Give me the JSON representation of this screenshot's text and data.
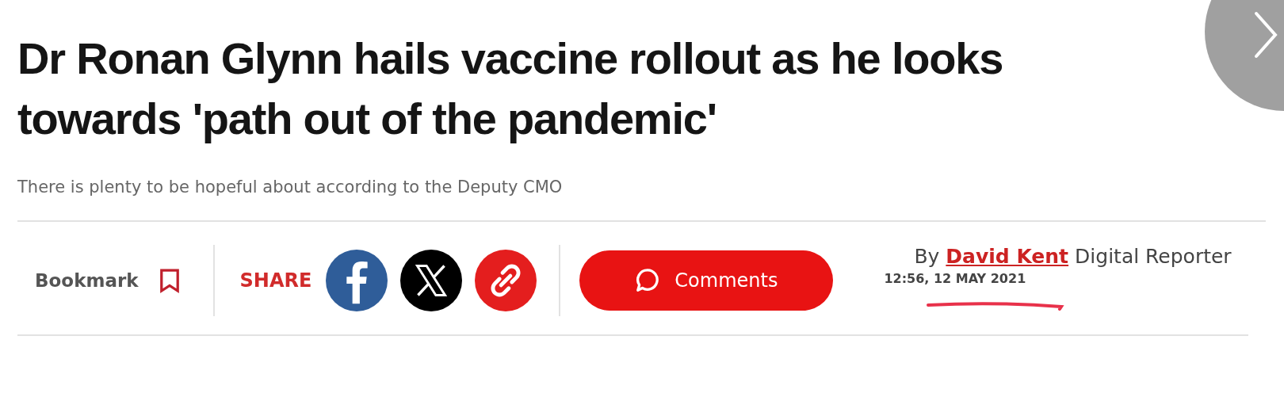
{
  "headline": "Dr Ronan Glynn hails vaccine rollout as he looks towards 'path out of the pandemic'",
  "standfirst": "There is plenty to be hopeful about according to the Deputy CMO",
  "bookmark": {
    "label": "Bookmark"
  },
  "share": {
    "label": "SHARE",
    "buttons": [
      {
        "kind": "facebook"
      },
      {
        "kind": "x"
      },
      {
        "kind": "link"
      }
    ]
  },
  "comments": {
    "label": "Comments"
  },
  "byline": {
    "prefix": "By",
    "author": "David Kent",
    "role": "Digital Reporter",
    "timestamp": "12:56, 12 MAY 2021"
  }
}
